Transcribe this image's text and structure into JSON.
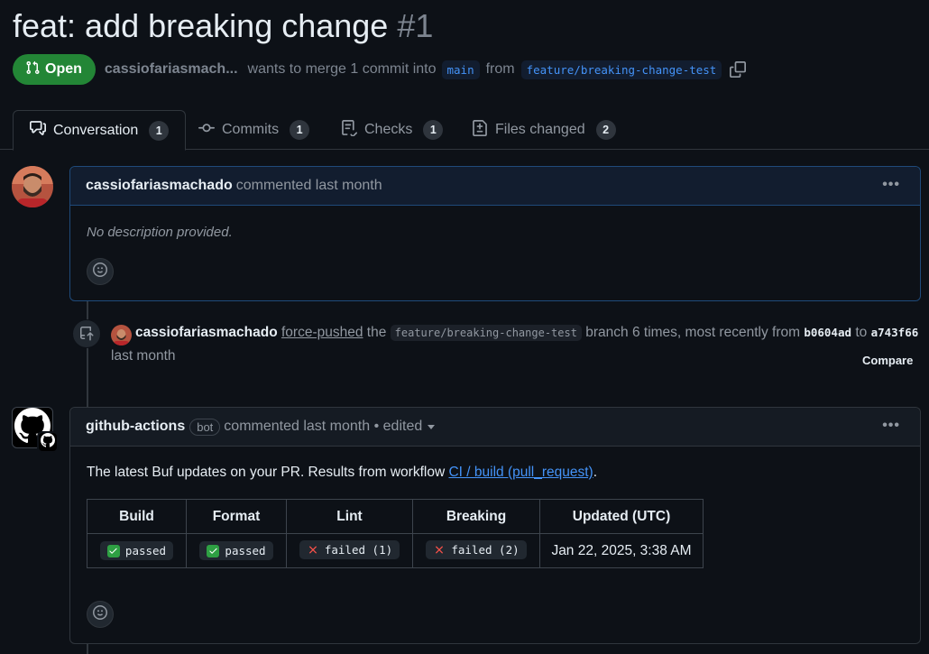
{
  "pr": {
    "title": "feat: add breaking change",
    "number": "#1",
    "state": "Open",
    "author": "cassiofariasmach...",
    "merge_text": "wants to merge 1 commit into",
    "base_branch": "main",
    "from_text": "from",
    "head_branch": "feature/breaking-change-test"
  },
  "tabs": [
    {
      "label": "Conversation",
      "count": "1"
    },
    {
      "label": "Commits",
      "count": "1"
    },
    {
      "label": "Checks",
      "count": "1"
    },
    {
      "label": "Files changed",
      "count": "2"
    }
  ],
  "comment1": {
    "author": "cassiofariasmachado",
    "meta": "commented last month",
    "body": "No description provided."
  },
  "event": {
    "author": "cassiofariasmachado",
    "action": "force-pushed",
    "the": "the",
    "branch": "feature/breaking-change-test",
    "text": "branch 6 times, most recently from",
    "from_sha": "b0604ad",
    "to": "to",
    "to_sha": "a743f66",
    "time": "last month",
    "compare": "Compare"
  },
  "comment2": {
    "author": "github-actions",
    "badge": "bot",
    "meta": "commented last month • edited",
    "intro": "The latest Buf updates on your PR. Results from workflow",
    "link": "CI / build (pull_request)",
    "period": ".",
    "table": {
      "headers": [
        "Build",
        "Format",
        "Lint",
        "Breaking",
        "Updated (UTC)"
      ],
      "row": [
        "passed",
        "passed",
        "failed (1)",
        "failed (2)",
        "Jan 22, 2025, 3:38 AM"
      ]
    }
  },
  "colors": {
    "open_green": "#238636",
    "link_blue": "#4493f8",
    "pass_green": "#2ea043",
    "fail_red": "#f85149"
  }
}
